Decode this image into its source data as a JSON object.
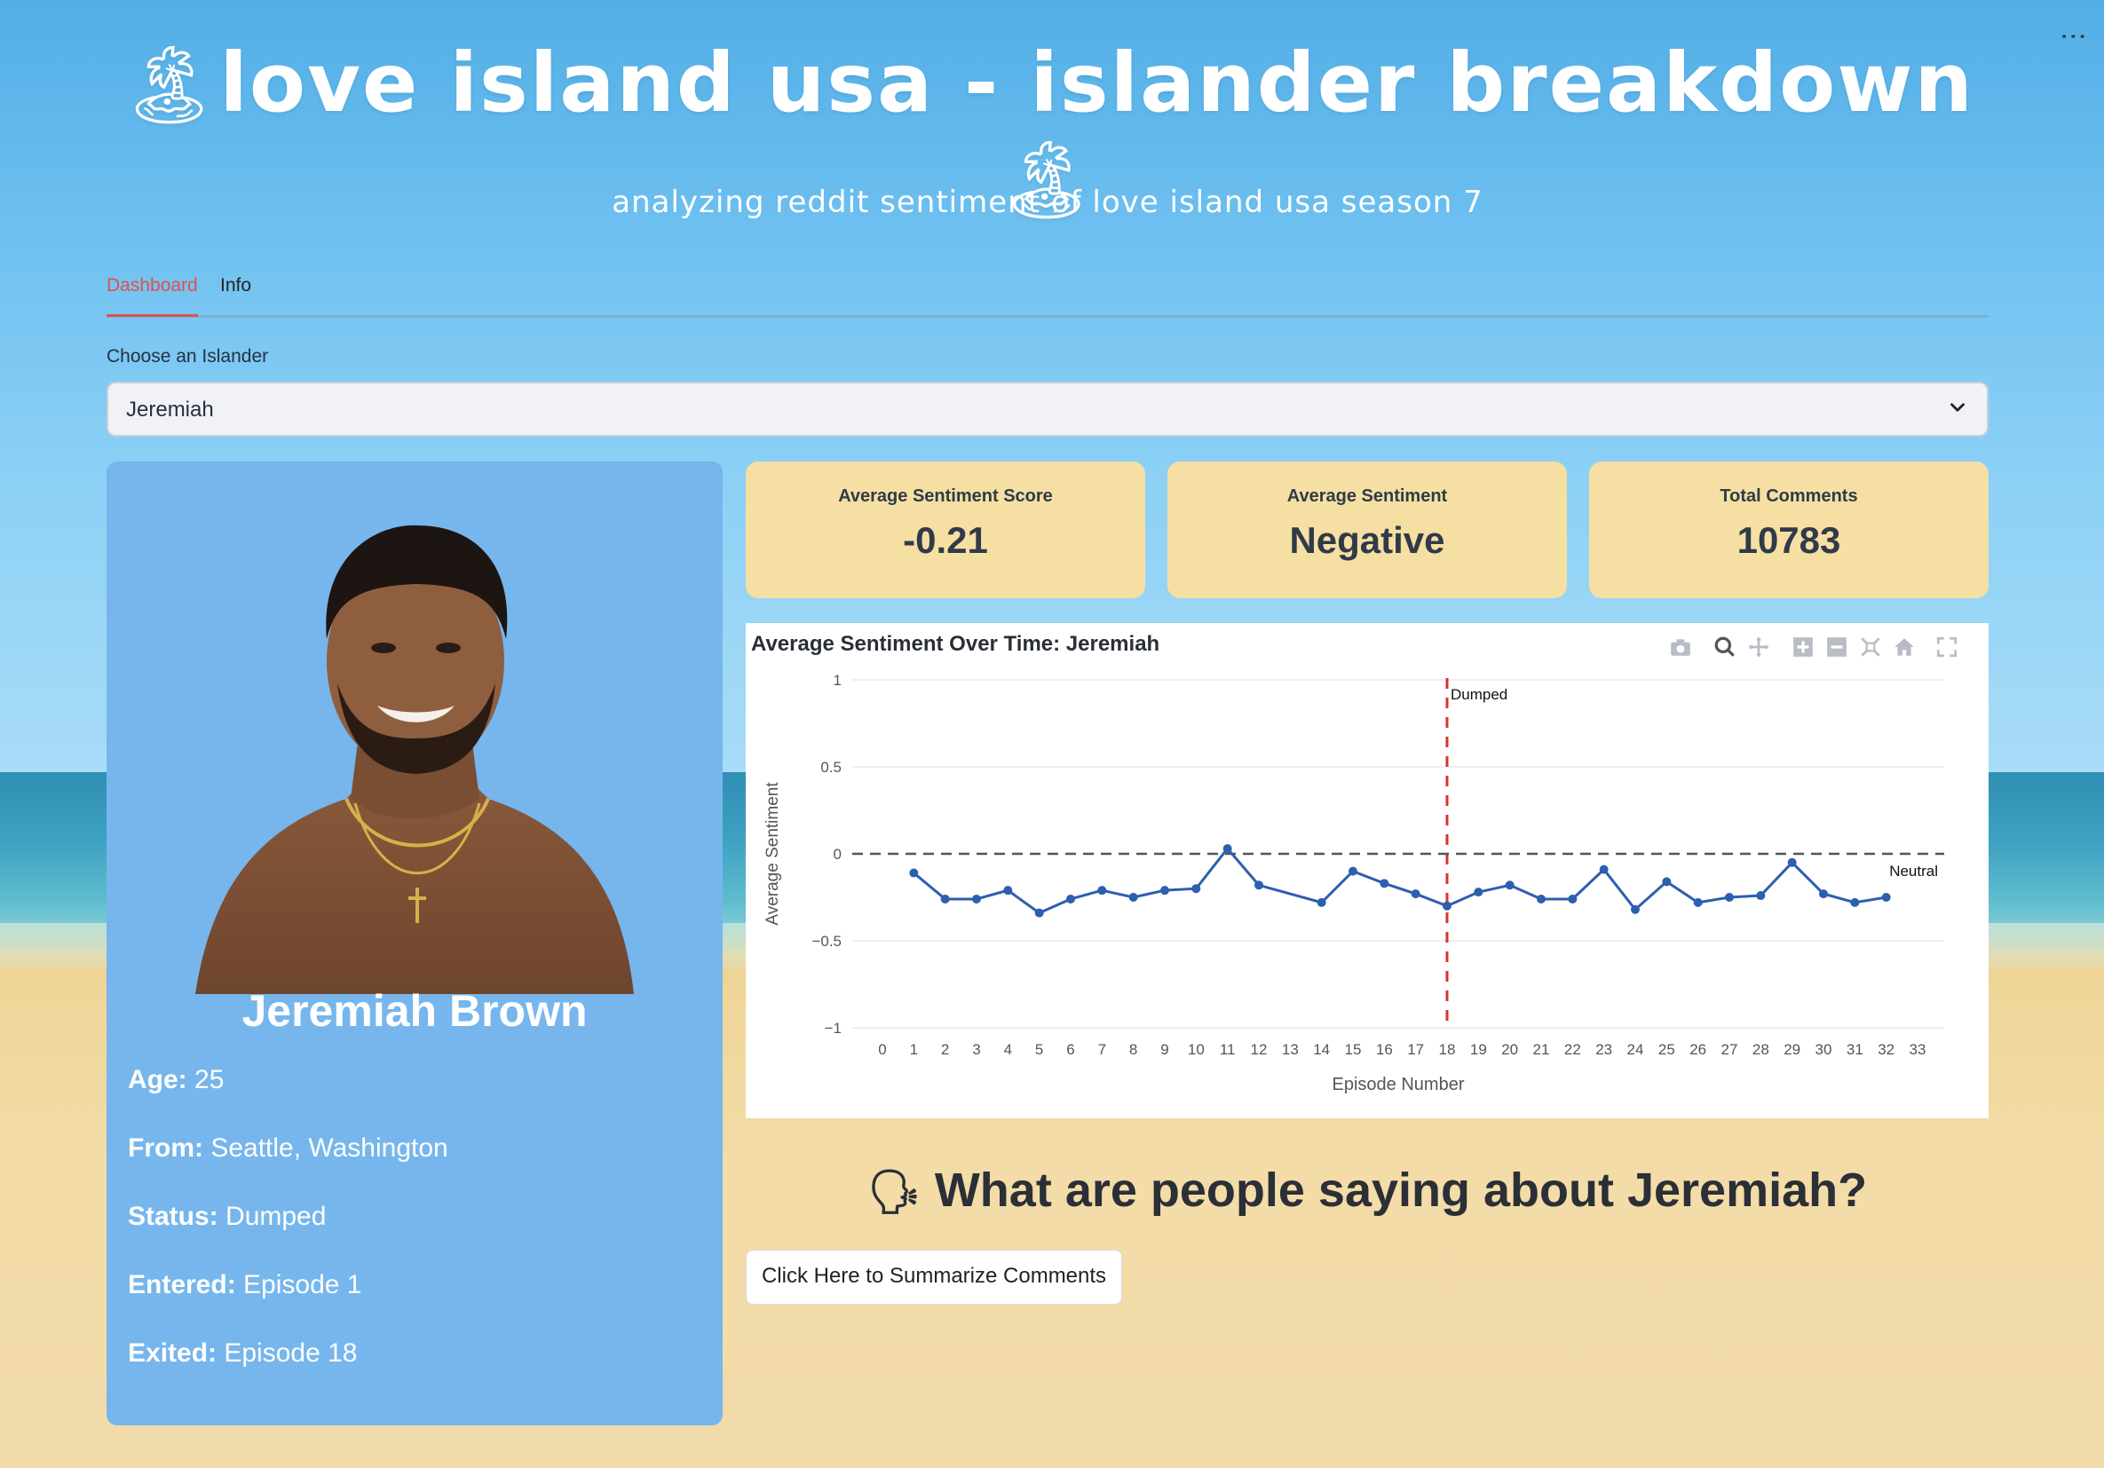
{
  "app": {
    "title_text": "love island usa - islander breakdown",
    "subtitle": "analyzing reddit sentiment of love island usa season 7",
    "palm_icon": "palm-island-icon"
  },
  "tabs": [
    {
      "label": "Dashboard",
      "active": true
    },
    {
      "label": "Info",
      "active": false
    }
  ],
  "selector": {
    "label": "Choose an Islander",
    "value": "Jeremiah"
  },
  "profile": {
    "name": "Jeremiah Brown",
    "facts": [
      {
        "key": "Age:",
        "value": " 25"
      },
      {
        "key": "From:",
        "value": " Seattle, Washington"
      },
      {
        "key": "Status:",
        "value": " Dumped"
      },
      {
        "key": "Entered:",
        "value": " Episode 1"
      },
      {
        "key": "Exited:",
        "value": " Episode 18"
      }
    ]
  },
  "metrics": [
    {
      "label": "Average Sentiment Score",
      "value": "-0.21"
    },
    {
      "label": "Average Sentiment",
      "value": "Negative"
    },
    {
      "label": "Total Comments",
      "value": "10783"
    }
  ],
  "chart_data": {
    "type": "line",
    "title": "Average Sentiment Over Time: Jeremiah",
    "xlabel": "Episode Number",
    "ylabel": "Average Sentiment",
    "xlim": [
      0,
      33
    ],
    "ylim": [
      -1,
      1
    ],
    "x_ticks": [
      0,
      1,
      2,
      3,
      4,
      5,
      6,
      7,
      8,
      9,
      10,
      11,
      12,
      13,
      14,
      15,
      16,
      17,
      18,
      19,
      20,
      21,
      22,
      23,
      24,
      25,
      26,
      27,
      28,
      29,
      30,
      31,
      32,
      33
    ],
    "y_ticks": [
      1,
      0.5,
      0,
      -0.5,
      -1
    ],
    "y_tick_labels": [
      "1",
      "0.5",
      "0",
      "−0.5",
      "−1"
    ],
    "x": [
      1,
      2,
      3,
      4,
      5,
      6,
      7,
      8,
      9,
      10,
      11,
      12,
      14,
      15,
      16,
      17,
      18,
      19,
      20,
      21,
      22,
      23,
      24,
      25,
      26,
      27,
      28,
      29,
      30,
      31,
      32
    ],
    "y": [
      -0.11,
      -0.26,
      -0.26,
      -0.21,
      -0.34,
      -0.26,
      -0.21,
      -0.25,
      -0.21,
      -0.2,
      0.03,
      -0.18,
      -0.28,
      -0.1,
      -0.17,
      -0.23,
      -0.3,
      -0.22,
      -0.18,
      -0.26,
      -0.26,
      -0.09,
      -0.32,
      -0.16,
      -0.28,
      -0.25,
      -0.24,
      -0.05,
      -0.23,
      -0.28,
      -0.25
    ],
    "series_color": "#2d5faf",
    "annotations": [
      {
        "type": "vline",
        "x": 18,
        "label": "Dumped",
        "color": "#d9332d"
      },
      {
        "type": "hline",
        "y": 0,
        "label": "Neutral",
        "color": "#555555"
      }
    ],
    "grid": true
  },
  "comments": {
    "heading": "What are people saying about Jeremiah?",
    "heading_icon": "speaking-head-icon",
    "button_label": "Click Here to Summarize Comments"
  }
}
